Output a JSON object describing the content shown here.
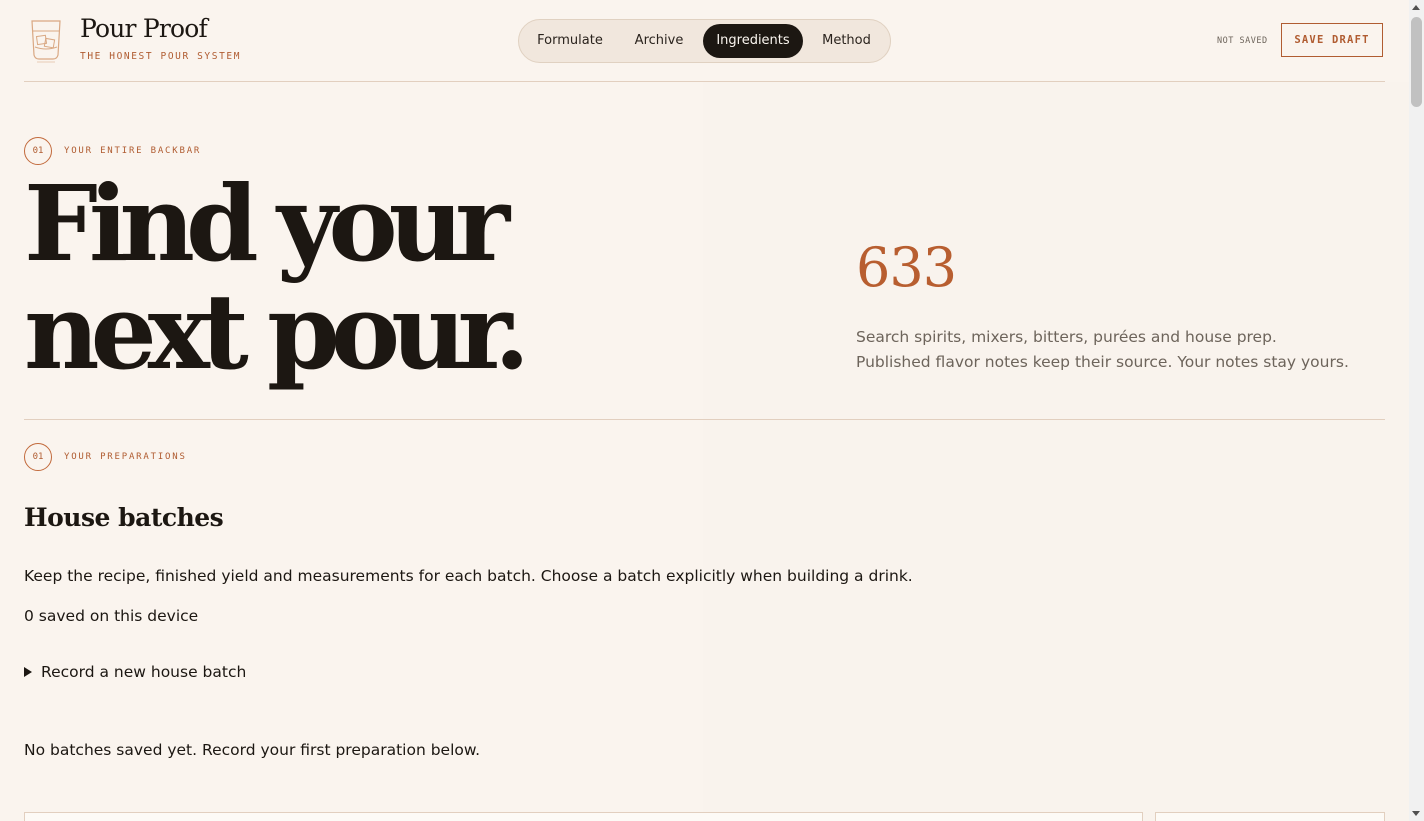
{
  "header": {
    "brand_name": "Pour Proof",
    "tagline": "THE HONEST POUR SYSTEM",
    "logo_icon": "rocks-glass-icon",
    "nav": [
      {
        "label": "Formulate",
        "active": false
      },
      {
        "label": "Archive",
        "active": false
      },
      {
        "label": "Ingredients",
        "active": true
      },
      {
        "label": "Method",
        "active": false
      }
    ],
    "save_status": "NOT SAVED",
    "save_button": "SAVE DRAFT"
  },
  "hero": {
    "section_number": "01",
    "section_label": "YOUR ENTIRE BACKBAR",
    "title_line1": "Find your",
    "title_line2": "next pour.",
    "count": "633",
    "description": "Search spirits, mixers, bitters, purées and house prep. Published flavor notes keep their source. Your notes stay yours."
  },
  "preparations": {
    "section_number": "01",
    "section_label": "YOUR PREPARATIONS",
    "title": "House batches",
    "description": "Keep the recipe, finished yield and measurements for each batch. Choose a batch explicitly when building a drink.",
    "saved_count": "0 saved on this device",
    "record_toggle": "Record a new house batch",
    "empty_state": "No batches saved yet. Record your first preparation below."
  },
  "colors": {
    "background": "#faf4ee",
    "accent": "#b05c31",
    "ink": "#1c1712",
    "muted": "#6d645b",
    "rule": "#e2cfbf"
  }
}
